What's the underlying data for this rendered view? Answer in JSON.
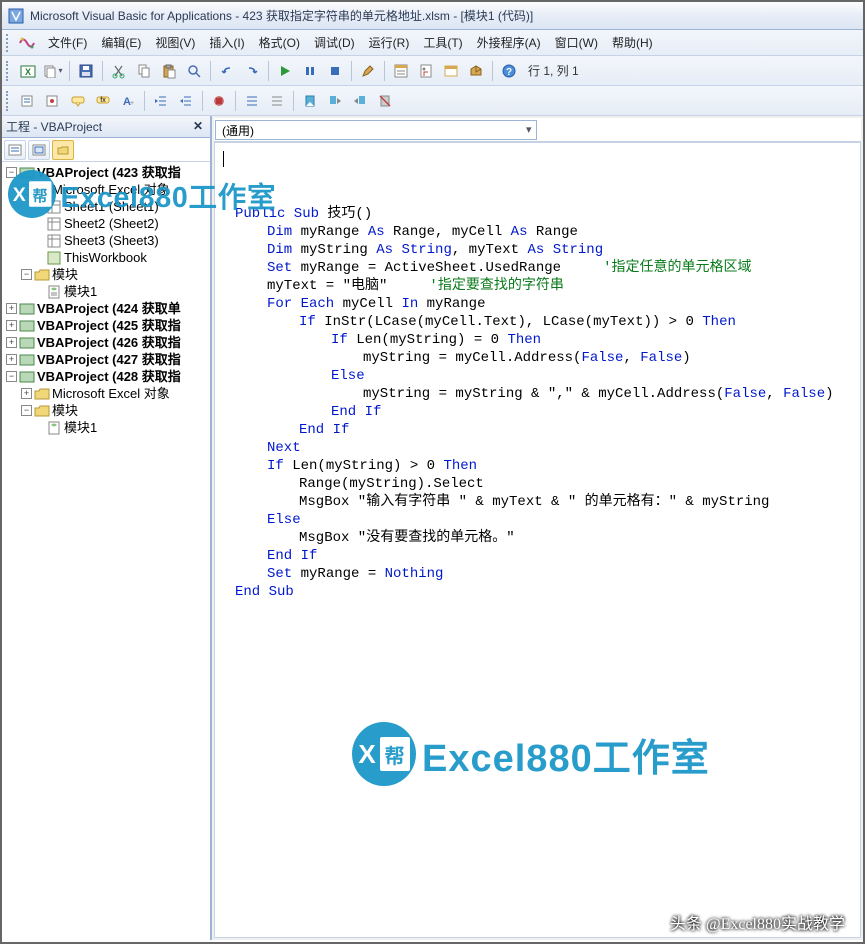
{
  "title": "Microsoft Visual Basic for Applications - 423 获取指定字符串的单元格地址.xlsm - [模块1 (代码)]",
  "menu": {
    "file": "文件(F)",
    "edit": "编辑(E)",
    "view": "视图(V)",
    "insert": "插入(I)",
    "format": "格式(O)",
    "debug": "调试(D)",
    "run": "运行(R)",
    "tools": "工具(T)",
    "addins": "外接程序(A)",
    "window": "窗口(W)",
    "help": "帮助(H)"
  },
  "toolbar": {
    "status": "行 1, 列 1"
  },
  "project": {
    "title": "工程 - VBAProject",
    "nodes": {
      "p423": "VBAProject (423 获取指",
      "excel_obj": "Microsoft Excel 对象",
      "sheet1": "Sheet1 (Sheet1)",
      "sheet2": "Sheet2 (Sheet2)",
      "sheet3": "Sheet3 (Sheet3)",
      "thiswb": "ThisWorkbook",
      "modules": "模块",
      "module1": "模块1",
      "p424": "VBAProject (424 获取单",
      "p425": "VBAProject (425 获取指",
      "p426": "VBAProject (426 获取指",
      "p427": "VBAProject (427 获取指",
      "p428": "VBAProject (428 获取指",
      "excel_obj2": "Microsoft Excel 对象",
      "modules2": "模块",
      "module1b": "模块1"
    }
  },
  "code": {
    "dropdown_left": "(通用)",
    "lines": [
      {
        "indent": 0,
        "parts": [
          {
            "t": "Public Sub ",
            "c": "kw"
          },
          {
            "t": "技巧()"
          }
        ]
      },
      {
        "indent": 1,
        "parts": [
          {
            "t": "Dim ",
            "c": "kw"
          },
          {
            "t": "myRange "
          },
          {
            "t": "As ",
            "c": "kw"
          },
          {
            "t": "Range, myCell "
          },
          {
            "t": "As ",
            "c": "kw"
          },
          {
            "t": "Range"
          }
        ]
      },
      {
        "indent": 1,
        "parts": [
          {
            "t": "Dim ",
            "c": "kw"
          },
          {
            "t": "myString "
          },
          {
            "t": "As String",
            "c": "kw"
          },
          {
            "t": ", myText "
          },
          {
            "t": "As String",
            "c": "kw"
          }
        ]
      },
      {
        "indent": 1,
        "parts": [
          {
            "t": "Set ",
            "c": "kw"
          },
          {
            "t": "myRange = ActiveSheet.UsedRange     "
          },
          {
            "t": "'指定任意的单元格区域",
            "c": "cm"
          }
        ]
      },
      {
        "indent": 1,
        "parts": [
          {
            "t": "myText = \"电脑\"     "
          },
          {
            "t": "'指定要查找的字符串",
            "c": "cm"
          }
        ]
      },
      {
        "indent": 1,
        "parts": [
          {
            "t": "For Each ",
            "c": "kw"
          },
          {
            "t": "myCell "
          },
          {
            "t": "In ",
            "c": "kw"
          },
          {
            "t": "myRange"
          }
        ]
      },
      {
        "indent": 2,
        "parts": [
          {
            "t": "If ",
            "c": "kw"
          },
          {
            "t": "InStr(LCase(myCell.Text), LCase(myText)) > 0 "
          },
          {
            "t": "Then",
            "c": "kw"
          }
        ]
      },
      {
        "indent": 3,
        "parts": [
          {
            "t": "If ",
            "c": "kw"
          },
          {
            "t": "Len(myString) = 0 "
          },
          {
            "t": "Then",
            "c": "kw"
          }
        ]
      },
      {
        "indent": 4,
        "parts": [
          {
            "t": "myString = myCell.Address("
          },
          {
            "t": "False",
            "c": "kw"
          },
          {
            "t": ", "
          },
          {
            "t": "False",
            "c": "kw"
          },
          {
            "t": ")"
          }
        ]
      },
      {
        "indent": 3,
        "parts": [
          {
            "t": "Else",
            "c": "kw"
          }
        ]
      },
      {
        "indent": 4,
        "parts": [
          {
            "t": "myString = myString & \",\" & myCell.Address("
          },
          {
            "t": "False",
            "c": "kw"
          },
          {
            "t": ", "
          },
          {
            "t": "False",
            "c": "kw"
          },
          {
            "t": ")"
          }
        ]
      },
      {
        "indent": 3,
        "parts": [
          {
            "t": "End If",
            "c": "kw"
          }
        ]
      },
      {
        "indent": 2,
        "parts": [
          {
            "t": "End If",
            "c": "kw"
          }
        ]
      },
      {
        "indent": 1,
        "parts": [
          {
            "t": "Next",
            "c": "kw"
          }
        ]
      },
      {
        "indent": 1,
        "parts": [
          {
            "t": "If ",
            "c": "kw"
          },
          {
            "t": "Len(myString) > 0 "
          },
          {
            "t": "Then",
            "c": "kw"
          }
        ]
      },
      {
        "indent": 2,
        "parts": [
          {
            "t": "Range(myString).Select"
          }
        ]
      },
      {
        "indent": 2,
        "parts": [
          {
            "t": "MsgBox \"输入有字符串 \" & myText & \" 的单元格有：\" & myString"
          }
        ]
      },
      {
        "indent": 1,
        "parts": [
          {
            "t": "Else",
            "c": "kw"
          }
        ]
      },
      {
        "indent": 2,
        "parts": [
          {
            "t": "MsgBox \"没有要查找的单元格。\""
          }
        ]
      },
      {
        "indent": 1,
        "parts": [
          {
            "t": "End If",
            "c": "kw"
          }
        ]
      },
      {
        "indent": 1,
        "parts": [
          {
            "t": "Set ",
            "c": "kw"
          },
          {
            "t": "myRange = "
          },
          {
            "t": "Nothing",
            "c": "kw"
          }
        ]
      },
      {
        "indent": 0,
        "parts": [
          {
            "t": "End Sub",
            "c": "kw"
          }
        ]
      }
    ]
  },
  "watermark": "Excel880工作室",
  "credit": "头条 @Excel880实战教学"
}
